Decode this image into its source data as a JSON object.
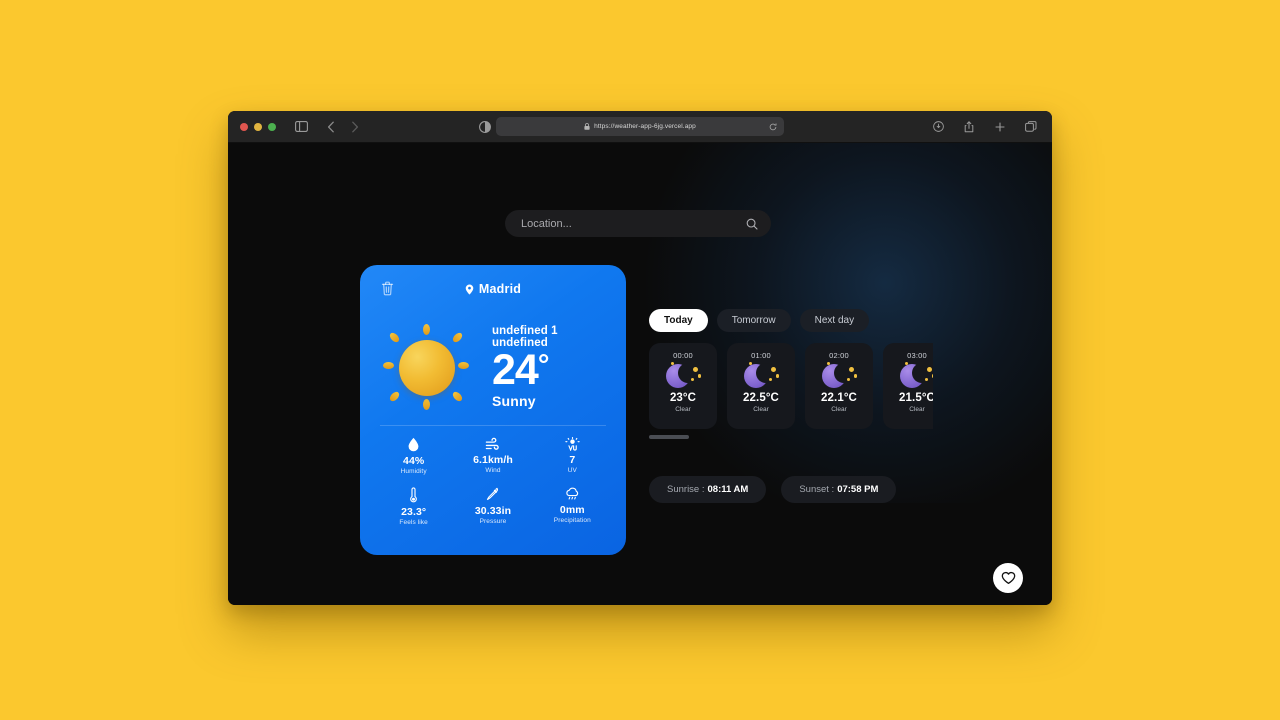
{
  "browser": {
    "url": "https://weather-app-6jg.vercel.app",
    "lock_icon": "lock-icon",
    "reload_icon": "reload-icon",
    "sidebar_icon": "sidebar-toggle-icon",
    "back_icon": "chevron-left-icon",
    "forward_icon": "chevron-right-icon",
    "reader_icon": "reader-mode-icon",
    "right_icons": [
      {
        "name": "extensions-icon"
      },
      {
        "name": "share-icon"
      },
      {
        "name": "new-tab-icon"
      },
      {
        "name": "tab-overview-icon"
      }
    ]
  },
  "search": {
    "placeholder": "Location...",
    "value": "",
    "icon": "search-icon"
  },
  "weather_card": {
    "delete_icon": "trash-icon",
    "pin_icon": "location-pin-icon",
    "city": "Madrid",
    "date": "undefined 1 undefined",
    "temperature": "24",
    "degree_symbol": "°",
    "condition": "Sunny",
    "condition_icon": "sun-icon",
    "stats": [
      {
        "icon": "humidity-drop-icon",
        "value": "44%",
        "label": "Humidity"
      },
      {
        "icon": "wind-icon",
        "value": "6.1km/h",
        "label": "Wind"
      },
      {
        "icon": "uv-sun-icon",
        "value": "7",
        "label": "UV"
      },
      {
        "icon": "thermometer-icon",
        "value": "23.3°",
        "label": "Feels like"
      },
      {
        "icon": "pressure-gauge-icon",
        "value": "30.33in",
        "label": "Pressure"
      },
      {
        "icon": "precipitation-cloud-icon",
        "value": "0mm",
        "label": "Precipitation"
      }
    ]
  },
  "forecast": {
    "tabs": [
      {
        "label": "Today",
        "active": true
      },
      {
        "label": "Tomorrow",
        "active": false
      },
      {
        "label": "Next day",
        "active": false
      }
    ],
    "hours": [
      {
        "time": "00:00",
        "temp": "23°C",
        "condition": "Clear",
        "icon": "moon-stars-icon"
      },
      {
        "time": "01:00",
        "temp": "22.5°C",
        "condition": "Clear",
        "icon": "moon-stars-icon"
      },
      {
        "time": "02:00",
        "temp": "22.1°C",
        "condition": "Clear",
        "icon": "moon-stars-icon"
      },
      {
        "time": "03:00",
        "temp": "21.5°C",
        "condition": "Clear",
        "icon": "moon-stars-icon"
      }
    ]
  },
  "sun_times": {
    "sunrise_label": "Sunrise :",
    "sunrise_value": "08:11 AM",
    "sunset_label": "Sunset :",
    "sunset_value": "07:58 PM"
  },
  "favorite_button": {
    "icon": "heart-icon"
  },
  "colors": {
    "page_background": "#fbc82e",
    "window_background": "#0b0b0b",
    "card_blue_light": "#2288f7",
    "card_blue_dark": "#0a64e2",
    "sun_gold": "#f2bc33",
    "moon_purple": "#8b6fd6",
    "star_gold": "#f0c040",
    "active_tab": "#ffffff"
  }
}
